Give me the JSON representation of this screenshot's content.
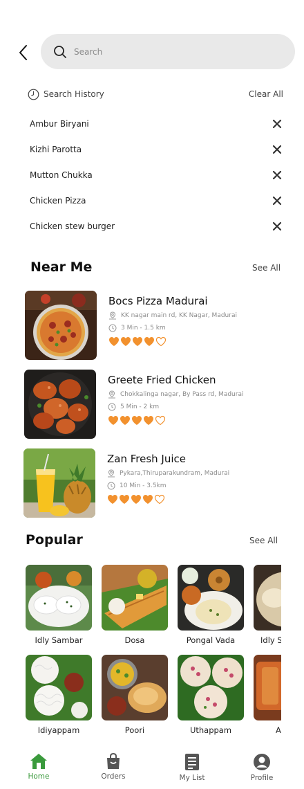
{
  "search": {
    "placeholder": "Search"
  },
  "history": {
    "title": "Search History",
    "clear_label": "Clear All",
    "items": [
      "Ambur Biryani",
      "Kizhi Parotta",
      "Mutton Chukka",
      "Chicken Pizza",
      "Chicken stew burger"
    ]
  },
  "near_me": {
    "title": "Near Me",
    "see_all": "See All",
    "restaurants": [
      {
        "name": "Bocs Pizza Madurai",
        "address": "KK nagar main rd, KK Nagar, Madurai",
        "eta": "3 Min - 1.5 km",
        "rating": 4,
        "rating_max": 5
      },
      {
        "name": "Greete Fried Chicken",
        "address": "Chokkalinga nagar, By Pass rd, Madurai",
        "eta": "5 Min - 2 km",
        "rating": 4,
        "rating_max": 5
      },
      {
        "name": "Zan Fresh Juice",
        "address": "Pykara,Thiruparakundram, Madurai",
        "eta": "10 Min - 3.5km",
        "rating": 4,
        "rating_max": 5
      }
    ]
  },
  "popular": {
    "title": "Popular",
    "see_all": "See All",
    "items": [
      "Idly Sambar",
      "Dosa",
      "Pongal Vada",
      "Idly S",
      "Idiyappam",
      "Poori",
      "Uthappam",
      "A"
    ]
  },
  "nav": {
    "items": [
      {
        "label": "Home",
        "icon": "home-icon",
        "active": true
      },
      {
        "label": "Orders",
        "icon": "shopping-bag-icon",
        "active": false
      },
      {
        "label": "My List",
        "icon": "list-document-icon",
        "active": false
      },
      {
        "label": "Profile",
        "icon": "profile-icon",
        "active": false
      }
    ]
  },
  "colors": {
    "accent": "#3a9a3c",
    "heart": "#f2912e",
    "search_bg": "#e9e9e9"
  }
}
